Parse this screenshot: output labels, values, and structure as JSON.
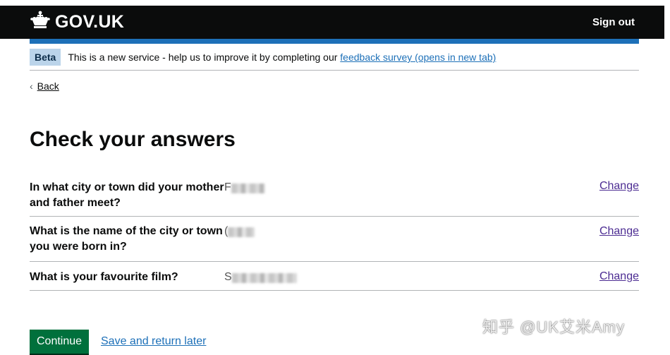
{
  "header": {
    "logo_text": "GOV.UK",
    "logo_icon": "crown-icon",
    "sign_out_label": "Sign out",
    "accent_color": "#1d70b8"
  },
  "phase_banner": {
    "tag": "Beta",
    "text": "This is a new service - help us to improve it by completing our ",
    "link_text": "feedback survey (opens in new tab)"
  },
  "back_link": {
    "icon": "chevron-left-icon",
    "label": "Back"
  },
  "page_title": "Check your answers",
  "summary_rows": [
    {
      "question": "In what city or town did your mother and father meet?",
      "answer_visible": "F",
      "action": "Change"
    },
    {
      "question": "What is the name of the city or town you were born in?",
      "answer_visible": "(",
      "action": "Change"
    },
    {
      "question": "What is your favourite film?",
      "answer_visible": "S",
      "action": "Change"
    }
  ],
  "actions": {
    "continue_label": "Continue",
    "save_label": "Save and return later",
    "continue_color": "#00703c"
  },
  "watermark": "知乎 @UK艾米Amy"
}
